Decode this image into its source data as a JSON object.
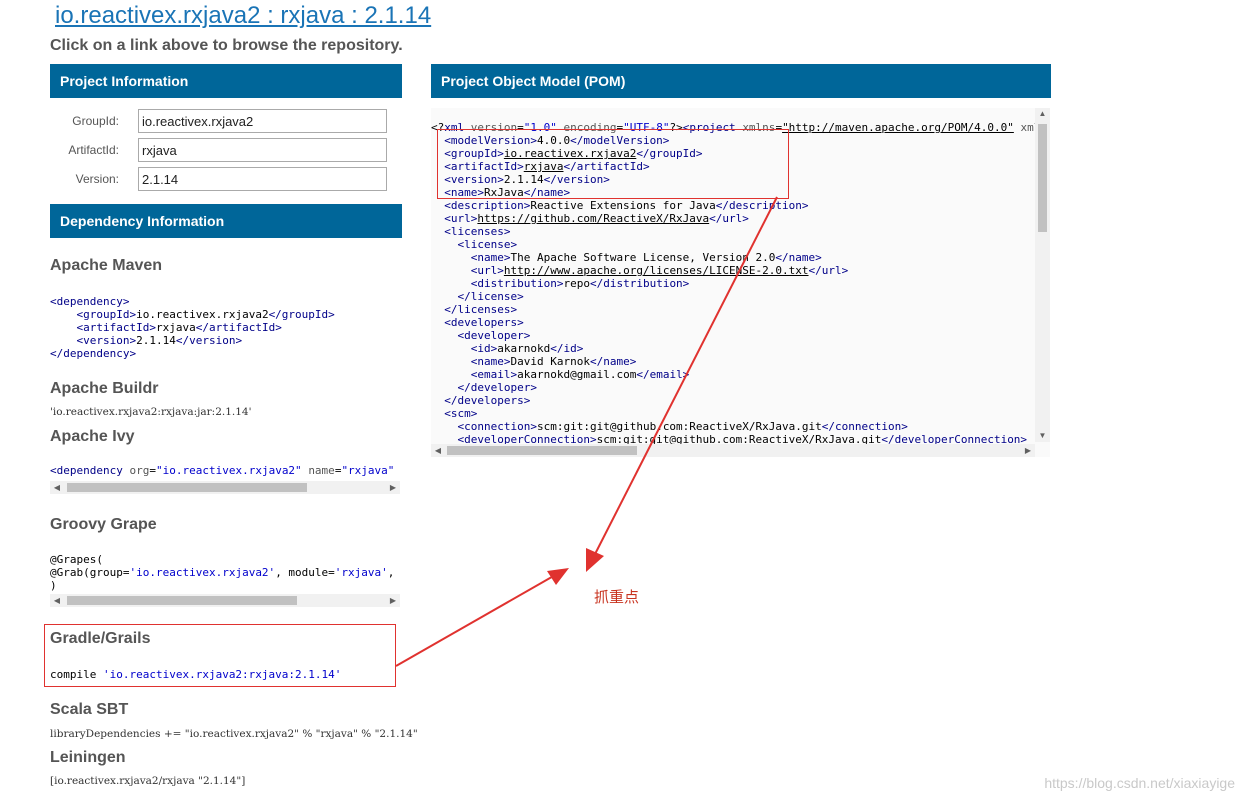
{
  "header": {
    "title": "io.reactivex.rxjava2 : rxjava : 2.1.14",
    "subtitle": "Click on a link above to browse the repository."
  },
  "project_info": {
    "heading": "Project Information",
    "group_label": "GroupId:",
    "group_value": "io.reactivex.rxjava2",
    "artifact_label": "ArtifactId:",
    "artifact_value": "rxjava",
    "version_label": "Version:",
    "version_value": "2.1.14"
  },
  "dependency_info": {
    "heading": "Dependency Information",
    "maven_title": "Apache Maven",
    "buildr_title": "Apache Buildr",
    "buildr_code": "'io.reactivex.rxjava2:rxjava:jar:2.1.14'",
    "ivy_title": "Apache Ivy",
    "grape_title": "Groovy Grape",
    "gradle_title": "Gradle/Grails",
    "sbt_title": "Scala SBT",
    "sbt_code": "libraryDependencies += \"io.reactivex.rxjava2\" % \"rxjava\" % \"2.1.14\"",
    "lein_title": "Leiningen",
    "lein_code": "[io.reactivex.rxjava2/rxjava \"2.1.14\"]"
  },
  "pom": {
    "heading": "Project Object Model (POM)"
  },
  "annotation": {
    "note": "抓重点",
    "color": "#e0322f"
  },
  "watermark": "https://blog.csdn.net/xiaxiayige",
  "colors": {
    "header_bg": "#006699",
    "link": "#1a74b6",
    "xml_tag": "#000088",
    "xml_string": "#0000cc"
  }
}
